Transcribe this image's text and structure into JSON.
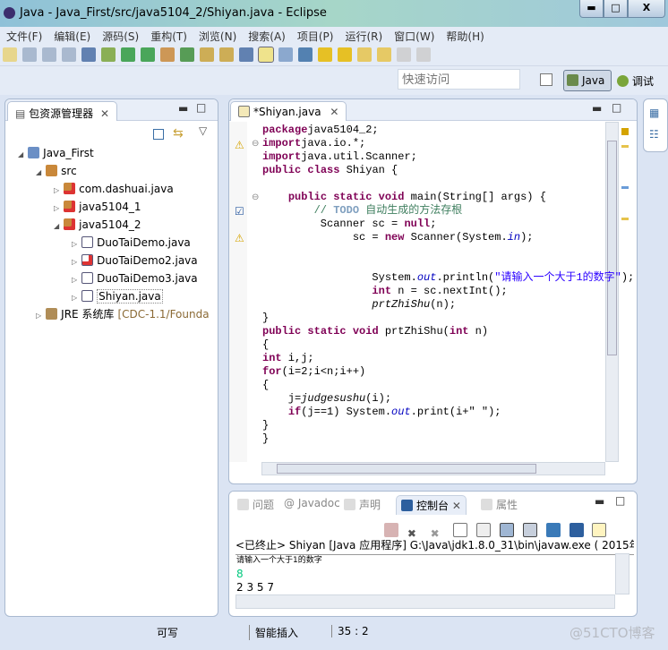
{
  "window": {
    "title": "Java  -  Java_First/src/java5104_2/Shiyan.java  -  Eclipse",
    "minimize": "▬",
    "maximize": "□",
    "close": "X"
  },
  "menu": [
    "文件(F)",
    "编辑(E)",
    "源码(S)",
    "重构(T)",
    "浏览(N)",
    "搜索(A)",
    "项目(P)",
    "运行(R)",
    "窗口(W)",
    "帮助(H)"
  ],
  "quick_access": {
    "placeholder": "快速访问"
  },
  "perspectives": {
    "java": "Java",
    "debug": "调试"
  },
  "explorer": {
    "tab": "包资源管理器",
    "tree": [
      {
        "label": "Java_First",
        "level": 0,
        "expand": "◢",
        "icon": "project"
      },
      {
        "label": "src",
        "level": 1,
        "expand": "◢",
        "icon": "package-folder"
      },
      {
        "label": "com.dashuai.java",
        "level": 2,
        "expand": "▷",
        "icon": "package-error"
      },
      {
        "label": "java5104_1",
        "level": 2,
        "expand": "▷",
        "icon": "package-error"
      },
      {
        "label": "java5104_2",
        "level": 2,
        "expand": "◢",
        "icon": "package-error"
      },
      {
        "label": "DuoTaiDemo.java",
        "level": 3,
        "expand": "▷",
        "icon": "java-file"
      },
      {
        "label": "DuoTaiDemo2.java",
        "level": 3,
        "expand": "▷",
        "icon": "java-file-error"
      },
      {
        "label": "DuoTaiDemo3.java",
        "level": 3,
        "expand": "▷",
        "icon": "java-file"
      },
      {
        "label": "Shiyan.java",
        "level": 3,
        "expand": "▷",
        "icon": "java-file",
        "selected": true
      },
      {
        "label": "JRE 系统库",
        "suffix": "[CDC-1.1/Founda",
        "level": 1,
        "expand": "▷",
        "icon": "library"
      }
    ]
  },
  "editor": {
    "tab": "*Shiyan.java",
    "lines": [
      [
        [
          "kw",
          "package"
        ],
        [
          "",
          "java5104_2;"
        ]
      ],
      [
        [
          "kw",
          "import"
        ],
        [
          "",
          "java.io.*;"
        ]
      ],
      [
        [
          "kw",
          "import"
        ],
        [
          "",
          "java.util.Scanner;"
        ]
      ],
      [
        [
          "kw",
          "public"
        ],
        [
          "",
          " "
        ],
        [
          "kw",
          "class"
        ],
        [
          "",
          " Shiyan {"
        ]
      ],
      [],
      [
        [
          "",
          "    "
        ],
        [
          "kw",
          "public"
        ],
        [
          "",
          " "
        ],
        [
          "kw",
          "static"
        ],
        [
          "",
          " "
        ],
        [
          "kw",
          "void"
        ],
        [
          "",
          " main(String[] args) {"
        ]
      ],
      [
        [
          "",
          "        "
        ],
        [
          "cm",
          "// "
        ],
        [
          "todo",
          "TODO"
        ],
        [
          "cm",
          " 自动生成的方法存根"
        ]
      ],
      [
        [
          "",
          "         Scanner sc = "
        ],
        [
          "kw",
          "null"
        ],
        [
          "",
          ";"
        ]
      ],
      [
        [
          "",
          "              sc = "
        ],
        [
          "kw",
          "new"
        ],
        [
          "",
          " Scanner(System."
        ],
        [
          "fi",
          "in"
        ],
        [
          "",
          ");"
        ]
      ],
      [],
      [],
      [
        [
          "",
          "                 System."
        ],
        [
          "fi",
          "out"
        ],
        [
          "",
          ".println("
        ],
        [
          "st",
          "\"请输入一个大于1的数字\""
        ],
        [
          "",
          ");"
        ]
      ],
      [
        [
          "",
          "                 "
        ],
        [
          "kw",
          "int"
        ],
        [
          "",
          " n = sc.nextInt();"
        ]
      ],
      [
        [
          "",
          "                 "
        ],
        [
          "it",
          "prtZhiShu"
        ],
        [
          "",
          "(n);"
        ]
      ],
      [
        [
          "",
          "}"
        ]
      ],
      [
        [
          "kw",
          "public"
        ],
        [
          "",
          " "
        ],
        [
          "kw",
          "static"
        ],
        [
          "",
          " "
        ],
        [
          "kw",
          "void"
        ],
        [
          "",
          " prtZhiShu("
        ],
        [
          "kw",
          "int"
        ],
        [
          "",
          " n)"
        ]
      ],
      [
        [
          "",
          "{"
        ]
      ],
      [
        [
          "kw",
          "int"
        ],
        [
          "",
          " i,j;"
        ]
      ],
      [
        [
          "kw",
          "for"
        ],
        [
          "",
          "(i=2;i<n;i++)"
        ]
      ],
      [
        [
          "",
          "{"
        ]
      ],
      [
        [
          "",
          "    j="
        ],
        [
          "it",
          "judgesushu"
        ],
        [
          "",
          "(i);"
        ]
      ],
      [
        [
          "",
          "    "
        ],
        [
          "kw",
          "if"
        ],
        [
          "",
          "(j==1) System."
        ],
        [
          "fi",
          "out"
        ],
        [
          "",
          ".print(i+\" \");"
        ]
      ],
      [
        [
          "",
          "}"
        ]
      ],
      [
        [
          "",
          "}"
        ]
      ]
    ]
  },
  "bottom": {
    "tabs": [
      "问题",
      "@ Javadoc",
      "声明",
      "控制台",
      "属性"
    ],
    "active": "控制台",
    "console_header": "<已终止> Shiyan [Java 应用程序] G:\\Java\\jdk1.8.0_31\\bin\\javaw.exe ( 2015年4,",
    "output": [
      {
        "text": "请输入一个大于1的数字",
        "color": "#000000"
      },
      {
        "text": "8",
        "color": "#00c87d"
      },
      {
        "text": "2 3 5 7",
        "color": "#000000"
      }
    ]
  },
  "status": {
    "writable": "可写",
    "insert_mode": "智能插入",
    "position": "35 : 2"
  },
  "watermark": "@51CTO博客"
}
